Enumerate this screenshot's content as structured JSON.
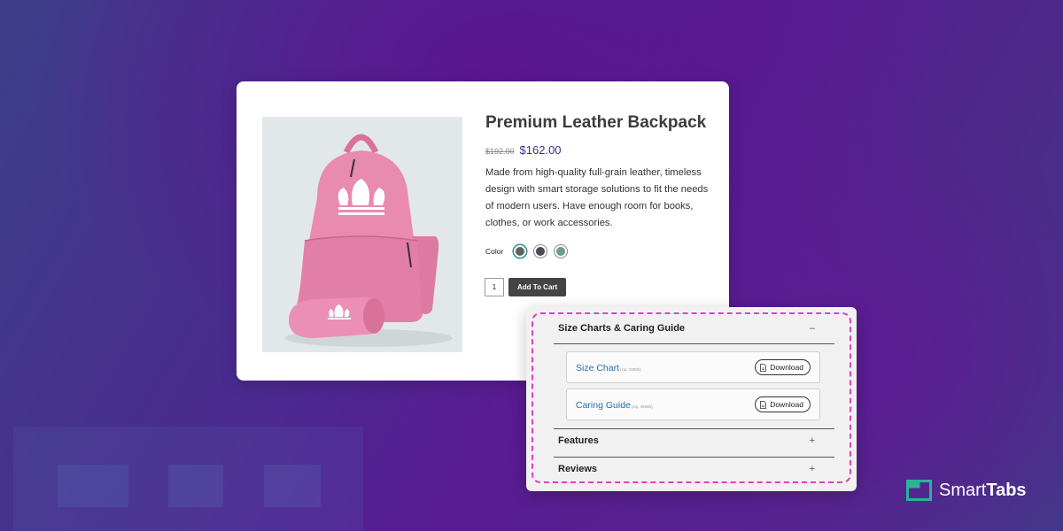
{
  "product": {
    "title": "Premium Leather Backpack",
    "old_price": "$192.00",
    "price": "$162.00",
    "description": "Made from high-quality full-grain leather,  timeless design with smart storage solutions to fit the needs of modern users. Have enough room for books, clothes, or work accessories.",
    "color_label": "Color",
    "swatches": [
      {
        "name": "slate",
        "color": "#5f6062",
        "selected": true
      },
      {
        "name": "charcoal",
        "color": "#4a4a52",
        "selected": false
      },
      {
        "name": "sage",
        "color": "#6e9c88",
        "selected": false
      }
    ],
    "quantity": "1",
    "add_to_cart_label": "Add To Cart",
    "image_colors": {
      "bag": "#e98aaf",
      "bag_shade": "#d87299",
      "background": "#e2e8e9"
    }
  },
  "tabs": {
    "size_chart_section": {
      "title": "Size Charts & Caring Guide",
      "toggle": "–"
    },
    "downloads": [
      {
        "name": "Size Chart",
        "meta": "(zip, 2908b)",
        "button": "Download"
      },
      {
        "name": "Caring Guide",
        "meta": "(zip, 4568b)",
        "button": "Download"
      }
    ],
    "features": {
      "title": "Features",
      "toggle": "+"
    },
    "reviews": {
      "title": "Reviews",
      "toggle": "+"
    }
  },
  "brand": {
    "name_part1": "Smart",
    "name_part2": "Tabs",
    "accent": "#2bb39a"
  }
}
